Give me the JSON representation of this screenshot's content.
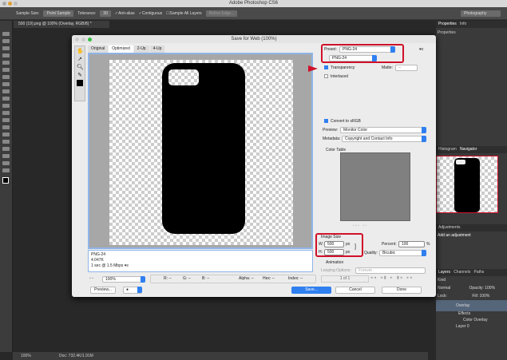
{
  "app": {
    "title": "Adobe Photoshop CS6",
    "workspace": "Photography"
  },
  "options_bar": {
    "sample_size_label": "Sample Size:",
    "sample_size": "Point Sample",
    "tolerance_label": "Tolerance:",
    "tolerance": "30",
    "anti_alias": "Anti-alias",
    "contiguous": "Contiguous",
    "sample_all": "Sample All Layers",
    "refine": "Refine Edge..."
  },
  "document": {
    "tab": "500 (19).png @ 100% (Overlay, RGB/8) *",
    "zoom": "100%",
    "doc_info": "Doc: 732.4K/1.91M"
  },
  "dialog": {
    "title": "Save for Web (100%)",
    "tabs": [
      "Original",
      "Optimized",
      "2-Up",
      "4-Up"
    ],
    "info": {
      "format": "PNG-24",
      "size": "4.047K",
      "time": "1 sec @ 1.5 Mbps"
    },
    "zoom": "100%",
    "readouts": {
      "r": "R: --",
      "g": "G: --",
      "b": "B: --",
      "alpha": "Alpha: --",
      "hex": "Hex: --",
      "index": "Index: --"
    },
    "preview_button": "Preview...",
    "save": "Save...",
    "cancel": "Cancel",
    "done": "Done",
    "settings": {
      "preset_label": "Preset:",
      "preset": "PNG-24",
      "format": "PNG-24",
      "transparency": "Transparency",
      "interlaced": "Interlaced",
      "matte_label": "Matte:",
      "matte": "--",
      "convert_srgb": "Convert to sRGB",
      "preview_label": "Preview:",
      "preview": "Monitor Color",
      "metadata_label": "Metadata:",
      "metadata": "Copyright and Contact Info",
      "color_table": "Color Table"
    },
    "image_size": {
      "title": "Image Size",
      "w_label": "W:",
      "w": "500",
      "h_label": "H:",
      "h": "500",
      "unit": "px",
      "percent_label": "Percent:",
      "percent": "100",
      "pct": "%",
      "quality_label": "Quality:",
      "quality": "Bicubic"
    },
    "animation": {
      "title": "Animation",
      "looping_label": "Looping Options:",
      "looping": "Forever",
      "frame": "1 of 1"
    }
  },
  "panels": {
    "properties_tabs": [
      "Properties",
      "Info"
    ],
    "properties_title": "Properties",
    "nav_tabs": [
      "Histogram",
      "Navigator"
    ],
    "adjustments_tab": "Adjustments",
    "adjustments_title": "Add an adjustment",
    "layers_tabs": [
      "Layers",
      "Channels",
      "Paths"
    ],
    "kind": "Kind",
    "blend": "Normal",
    "opacity_label": "Opacity:",
    "opacity": "100%",
    "lock_label": "Lock:",
    "fill_label": "Fill:",
    "fill": "100%",
    "layers": [
      "Overlay",
      "Effects",
      "Color Overlay",
      "Layer 0"
    ]
  },
  "colors": {
    "accent": "#2f7ff0",
    "highlight": "#d0102a"
  }
}
